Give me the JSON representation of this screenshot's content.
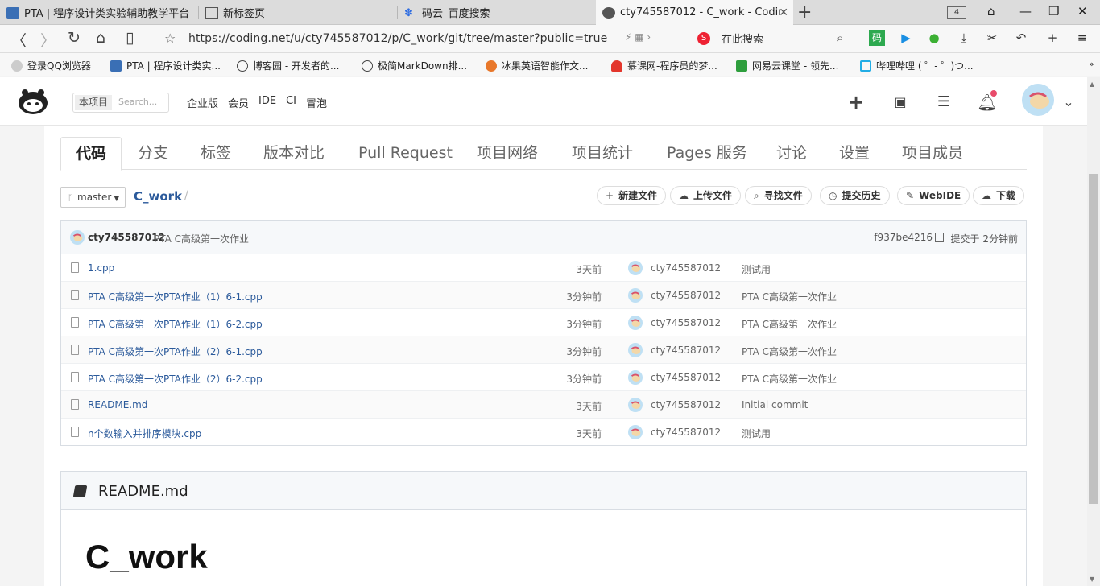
{
  "browser": {
    "tabs": [
      {
        "title": "PTA | 程序设计类实验辅助教学平台"
      },
      {
        "title": "新标签页"
      },
      {
        "title": "码云_百度搜索"
      },
      {
        "title": "cty745587012 - C_work - Coding.n"
      }
    ],
    "tab_count": "4",
    "url": "https://coding.net/u/cty745587012/p/C_work/git/tree/master?public=true",
    "search_placeholder": "在此搜索",
    "bookmarks": [
      {
        "label": "登录QQ浏览器"
      },
      {
        "label": "PTA | 程序设计类实..."
      },
      {
        "label": "博客园 - 开发者的..."
      },
      {
        "label": "极简MarkDown排..."
      },
      {
        "label": "冰果英语智能作文..."
      },
      {
        "label": "慕课网-程序员的梦..."
      },
      {
        "label": "网易云课堂 - 领先..."
      },
      {
        "label": "哔哩哔哩 ( ゜- ゜)つ..."
      }
    ]
  },
  "header": {
    "search_tag": "本项目",
    "search_placeholder": "Search...",
    "nav": [
      "企业版",
      "会员",
      "IDE",
      "CI",
      "冒泡"
    ]
  },
  "project_tabs": [
    "代码",
    "分支",
    "标签",
    "版本对比",
    "Pull Request",
    "项目网络",
    "项目统计",
    "Pages 服务",
    "讨论",
    "设置",
    "项目成员"
  ],
  "repo": {
    "branch": "master",
    "name": "C_work",
    "actions": [
      "新建文件",
      "上传文件",
      "寻找文件",
      "提交历史",
      "WebIDE",
      "下载"
    ]
  },
  "last_commit": {
    "user": "cty745587012",
    "message": "PTA C高级第一次作业",
    "hash": "f937be4216",
    "time": "提交于 2分钟前"
  },
  "files": [
    {
      "name": "1.cpp",
      "time": "3天前",
      "user": "cty745587012",
      "message": "测试用"
    },
    {
      "name": "PTA C高级第一次PTA作业（1）6-1.cpp",
      "time": "3分钟前",
      "user": "cty745587012",
      "message": "PTA C高级第一次作业"
    },
    {
      "name": "PTA C高级第一次PTA作业（1）6-2.cpp",
      "time": "3分钟前",
      "user": "cty745587012",
      "message": "PTA C高级第一次作业"
    },
    {
      "name": "PTA C高级第一次PTA作业（2）6-1.cpp",
      "time": "3分钟前",
      "user": "cty745587012",
      "message": "PTA C高级第一次作业"
    },
    {
      "name": "PTA C高级第一次PTA作业（2）6-2.cpp",
      "time": "3分钟前",
      "user": "cty745587012",
      "message": "PTA C高级第一次作业"
    },
    {
      "name": "README.md",
      "time": "3天前",
      "user": "cty745587012",
      "message": "Initial commit"
    },
    {
      "name": "n个数输入并排序模块.cpp",
      "time": "3天前",
      "user": "cty745587012",
      "message": "测试用"
    }
  ],
  "readme": {
    "title": "README.md",
    "heading": "C_work"
  }
}
